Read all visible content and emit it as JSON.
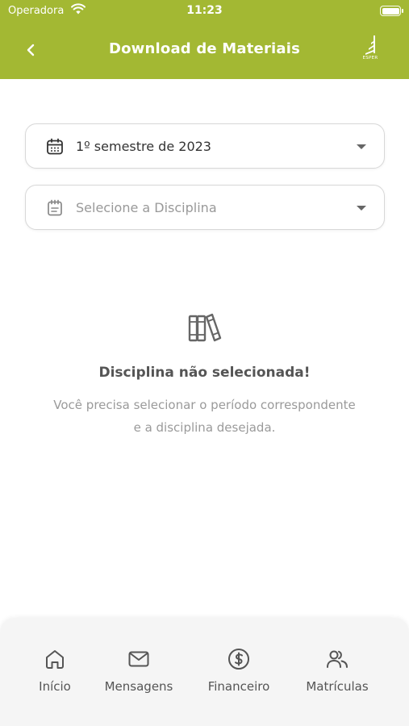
{
  "status_bar": {
    "carrier": "Operadora",
    "time": "11:23"
  },
  "header": {
    "title": "Download de Materiais",
    "logo_text": "ESPER",
    "background": "#a3b833"
  },
  "selects": {
    "period": {
      "value": "1º semestre de 2023",
      "icon": "calendar-icon"
    },
    "discipline": {
      "placeholder": "Selecione a Disciplina",
      "icon": "notepad-icon"
    }
  },
  "empty_state": {
    "icon": "books-icon",
    "title": "Disciplina não selecionada!",
    "description": "Você precisa selecionar o período correspondente e a disciplina desejada."
  },
  "tabbar": {
    "items": [
      {
        "label": "Início",
        "icon": "home-icon"
      },
      {
        "label": "Mensagens",
        "icon": "mail-icon"
      },
      {
        "label": "Financeiro",
        "icon": "dollar-icon"
      },
      {
        "label": "Matrículas",
        "icon": "users-icon"
      }
    ]
  }
}
